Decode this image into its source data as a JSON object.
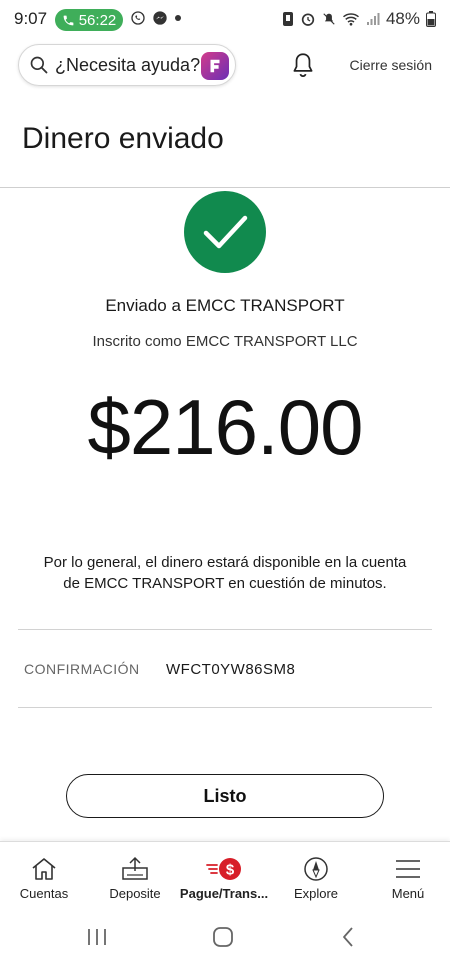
{
  "status_bar": {
    "time": "9:07",
    "call_duration": "56:22",
    "battery": "48%"
  },
  "header": {
    "help_text": "¿Necesita ayuda?",
    "logout_label": "Cierre sesión"
  },
  "page": {
    "title": "Dinero enviado"
  },
  "confirmation": {
    "sent_to": "Enviado a EMCC TRANSPORT",
    "enrolled_as": "Inscrito como EMCC TRANSPORT LLC",
    "amount": "$216.00",
    "availability_line1": "Por lo general, el dinero estará disponible en la cuenta",
    "availability_line2": "de EMCC TRANSPORT en cuestión de minutos.",
    "label": "CONFIRMACIÓN",
    "code": "WFCT0YW86SM8"
  },
  "done_button": "Listo",
  "bottom_nav": [
    {
      "label": "Cuentas",
      "icon": "home-icon",
      "active": false
    },
    {
      "label": "Deposite",
      "icon": "deposit-icon",
      "active": false
    },
    {
      "label": "Pague/Trans...",
      "icon": "pay-transfer-icon",
      "active": true
    },
    {
      "label": "Explore",
      "icon": "compass-icon",
      "active": false
    },
    {
      "label": "Menú",
      "icon": "menu-icon",
      "active": false
    }
  ],
  "colors": {
    "success_green": "#118a4e",
    "call_green": "#3fae5a",
    "active_red": "#d71e28"
  }
}
